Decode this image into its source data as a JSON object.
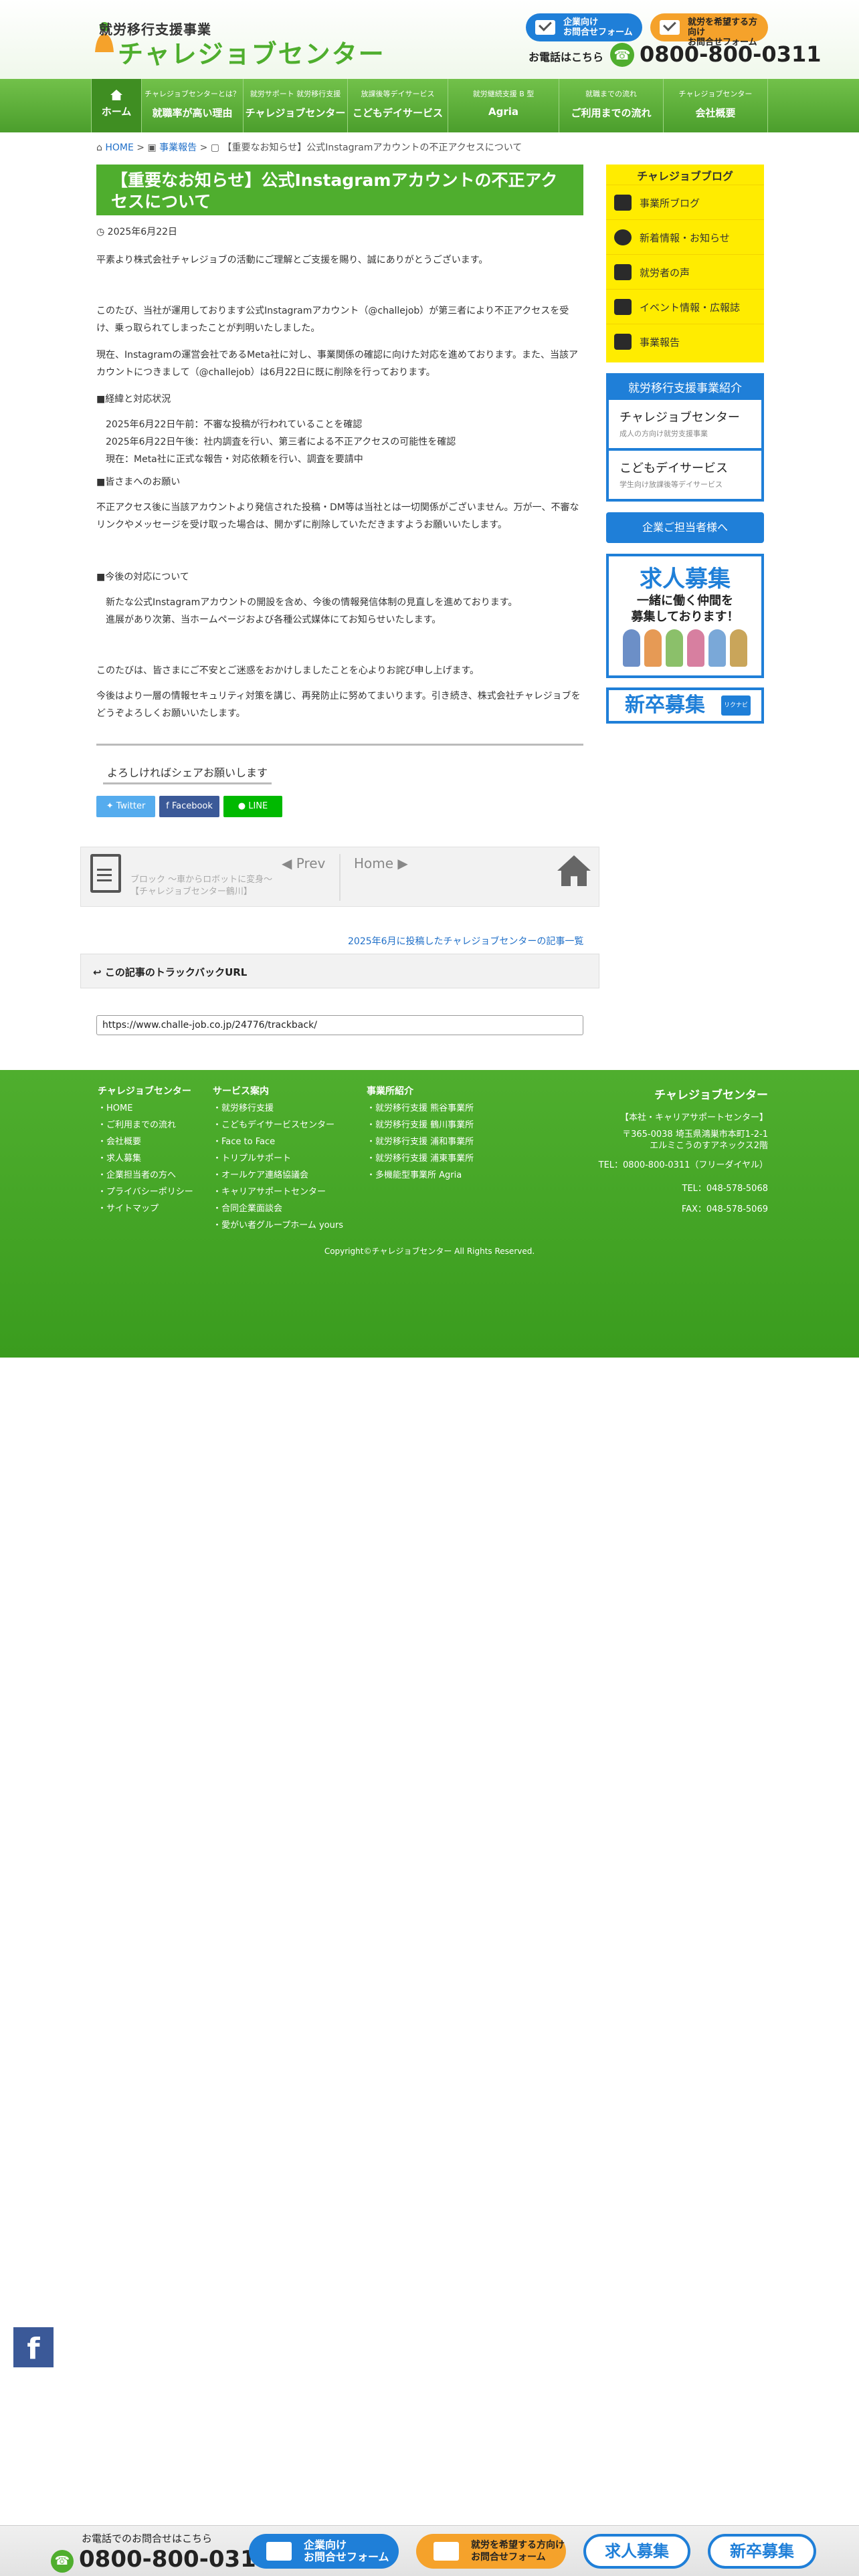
{
  "header": {
    "logo_sub": "就労移行支援事業",
    "logo_main": "チャレジョブセンター",
    "btn_corp": [
      "企業向け",
      "お問合せフォーム"
    ],
    "btn_user": [
      "就労を希望する方向け",
      "お問合せフォーム"
    ],
    "tel_label": "お電話はこちら",
    "tel": "0800-800-0311",
    "colors": {
      "green": "#4fae2e",
      "blue": "#1f7fd8",
      "orange": "#f5a22b",
      "yellow": "#ffec00"
    }
  },
  "nav": [
    {
      "small": "",
      "big": "ホーム",
      "icon": "home-icon"
    },
    {
      "small": "チャレジョブセンターとは？",
      "big": "就職率が高い理由"
    },
    {
      "small": "就労サポート 就労移行支援",
      "big": "チャレジョブセンター"
    },
    {
      "small": "放課後等デイサービス",
      "big": "こどもデイサービス"
    },
    {
      "small": "就労継続支援 B 型",
      "big": "Agria"
    },
    {
      "small": "就職までの流れ",
      "big": "ご利用までの流れ"
    },
    {
      "small": "チャレジョブセンター",
      "big": "会社概要"
    }
  ],
  "breadcrumb": {
    "home": "HOME",
    "cat": "事業報告",
    "current": "【重要なお知らせ】公式Instagramアカウントの不正アクセスについて"
  },
  "article": {
    "title": "【重要なお知らせ】公式Instagramアカウントの不正アクセスについて",
    "date": "2025年6月22日",
    "paragraphs": [
      "平素より株式会社チャレジョブの活動にご理解とご支援を賜り、誠にありがとうございます。",
      "このたび、当社が運用しております公式Instagramアカウント（@challejob）が第三者により不正アクセスを受け、乗っ取られてしまったことが判明いたしました。",
      "現在、Instagramの運営会社であるMeta社に対し、事業関係の確認に向けた対応を進めております。また、当該アカウントにつきまして（@challejob）は6月22日に既に削除を行っております。",
      "■経緯と対応状況",
      "2025年6月22日午前：不審な投稿が行われていることを確認",
      "2025年6月22日午後：社内調査を行い、第三者による不正アクセスの可能性を確認",
      "現在：Meta社に正式な報告・対応依頼を行い、調査を要請中",
      "■皆さまへのお願い",
      "不正アクセス後に当該アカウントより発信された投稿・DM等は当社とは一切関係がございません。万が一、不審なリンクやメッセージを受け取った場合は、開かずに削除していただきますようお願いいたします。",
      "■今後の対応について",
      "新たな公式Instagramアカウントの開設を含め、今後の情報発信体制の見直しを進めております。",
      "進展があり次第、当ホームページおよび各種公式媒体にてお知らせいたします。",
      "このたびは、皆さまにご不安とご迷惑をおかけしましたことを心よりお詫び申し上げます。",
      "今後はより一層の情報セキュリティ対策を講じ、再発防止に努めてまいります。引き続き、株式会社チャレジョブをどうぞよろしくお願いいたします。"
    ]
  },
  "share": {
    "label": "よろしければシェアお願いします",
    "twitter": "Twitter",
    "facebook": "Facebook",
    "line": "LINE"
  },
  "pager": {
    "prev": "Prev",
    "prev_title": "ブロック 〜車からロボットに変身〜【チャレジョブセンター鶴川】",
    "next": "Home"
  },
  "month_link": "2025年6月に投稿したチャレジョブセンターの記事一覧",
  "trackback": {
    "label": "この記事のトラックバックURL",
    "url": "https://www.challe-job.co.jp/24776/trackback/"
  },
  "sidebar": {
    "blog_title": "チャレジョブブログ",
    "blog_items": [
      "事業所ブログ",
      "新着情報・お知らせ",
      "就労者の声",
      "イベント情報・広報誌",
      "事業報告"
    ],
    "biz_title": "就労移行支援事業紹介",
    "biz_cards": [
      {
        "name": "チャレジョブセンター",
        "sub": "成人の方向け就労支援事業"
      },
      {
        "name": "こどもデイサービス",
        "sub": "学生向け放課後等デイサービス"
      }
    ],
    "corp_btn": "企業ご担当者様へ",
    "recruit_h": "求人募集",
    "recruit_t": [
      "一緒に働く仲間を",
      "募集しております！"
    ],
    "shinsotsu": "新卒募集",
    "shinsotsu_logo": "リクナビ"
  },
  "footer": {
    "col1_h": "チャレジョブセンター",
    "col1": [
      "HOME",
      "ご利用までの流れ",
      "会社概要",
      "求人募集",
      "企業担当者の方へ",
      "プライバシーポリシー",
      "サイトマップ"
    ],
    "col2_h": "サービス案内",
    "col2": [
      "就労移行支援",
      "こどもデイサービスセンター",
      "Face to Face",
      "トリプルサポート",
      "オールケア連絡協議会",
      "キャリアサポートセンター",
      "合同企業面談会",
      "愛がい者グループホーム yours"
    ],
    "col3_h": "事業所紹介",
    "col3": [
      "就労移行支援 熊谷事業所",
      "就労移行支援 鶴川事業所",
      "就労移行支援 浦和事業所",
      "就労移行支援 浦東事業所",
      "多機能型事業所 Agria"
    ],
    "company": "チャレジョブセンター",
    "branch": "【本社・キャリアサポートセンター】",
    "addr1": "〒365-0038 埼玉県鴻巣市本町1-2-1",
    "addr2": "エルミこうのすアネックス2階",
    "tel_free": "TEL：0800-800-0311（フリーダイヤル）",
    "tel": "TEL：048-578-5068",
    "fax": "FAX：048-578-5069",
    "copyright": "Copyright©チャレジョブセンター All Rights Reserved."
  },
  "bottom_bar": {
    "label": "お電話でのお問合せはこちら",
    "tel": "0800-800-0311",
    "corp": [
      "企業向け",
      "お問合せフォーム"
    ],
    "user": [
      "就労を希望する方向け",
      "お問合せフォーム"
    ],
    "recruit": "求人募集",
    "shinsotsu": "新卒募集"
  }
}
